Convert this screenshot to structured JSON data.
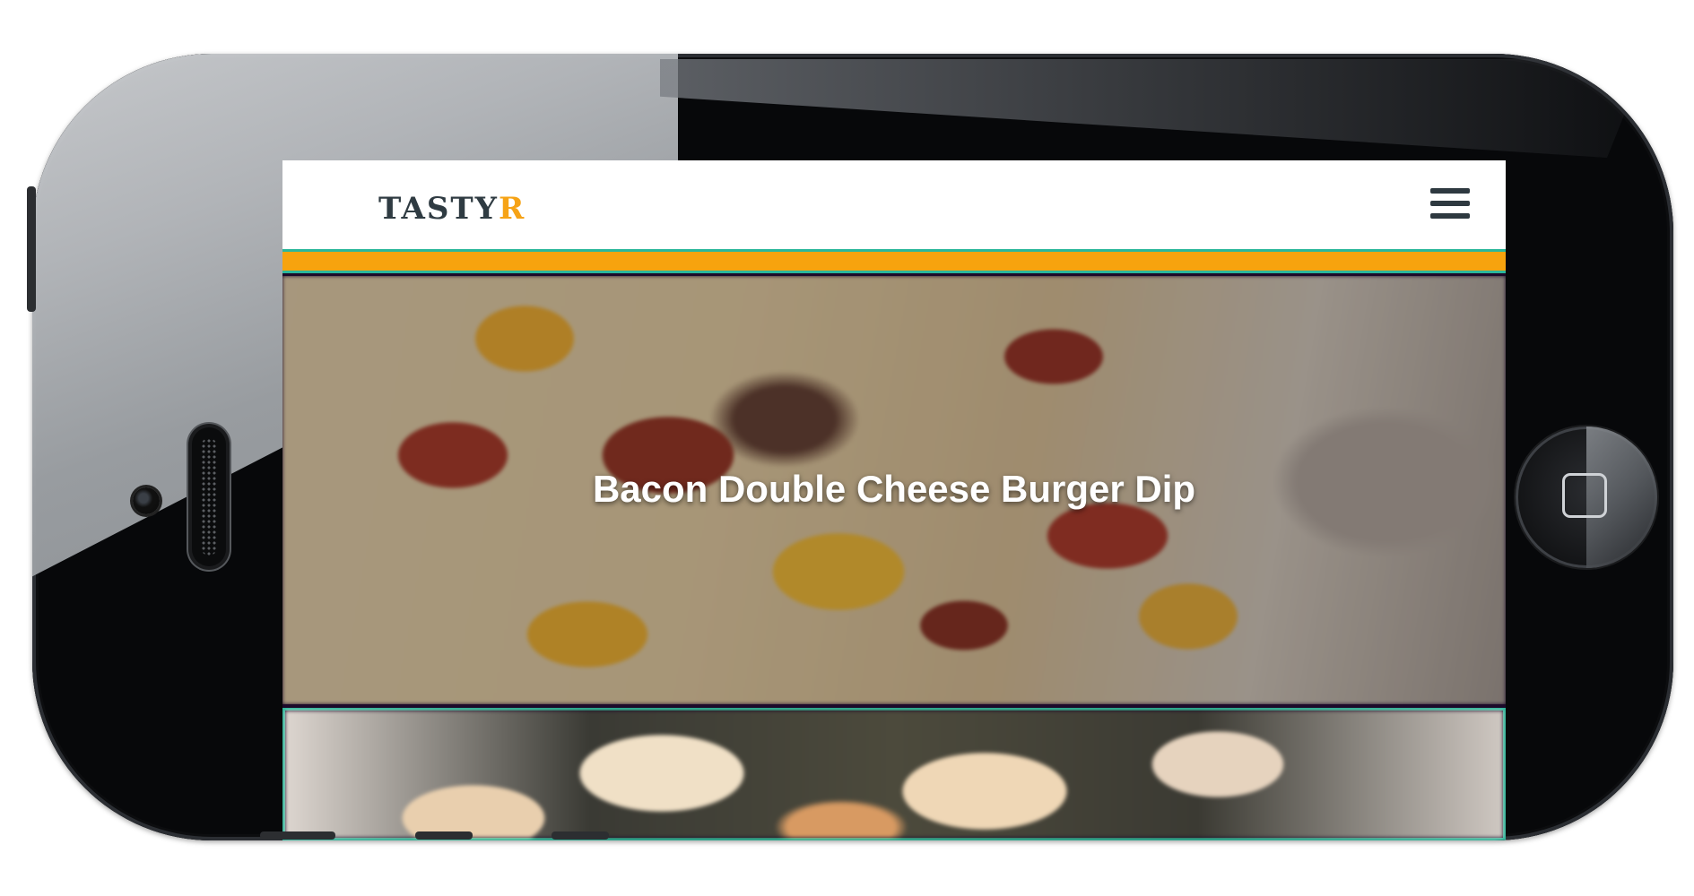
{
  "app": {
    "logo_main": "TASTY",
    "logo_accent": "R"
  },
  "header": {
    "menu_icon": "hamburger-menu-icon"
  },
  "colors": {
    "accent_orange": "#f7a30e",
    "accent_teal": "#2bb79b",
    "logo_dark": "#2f3b42"
  },
  "cards": [
    {
      "title": "Bacon Double Cheese Burger Dip"
    },
    {
      "title": ""
    }
  ]
}
